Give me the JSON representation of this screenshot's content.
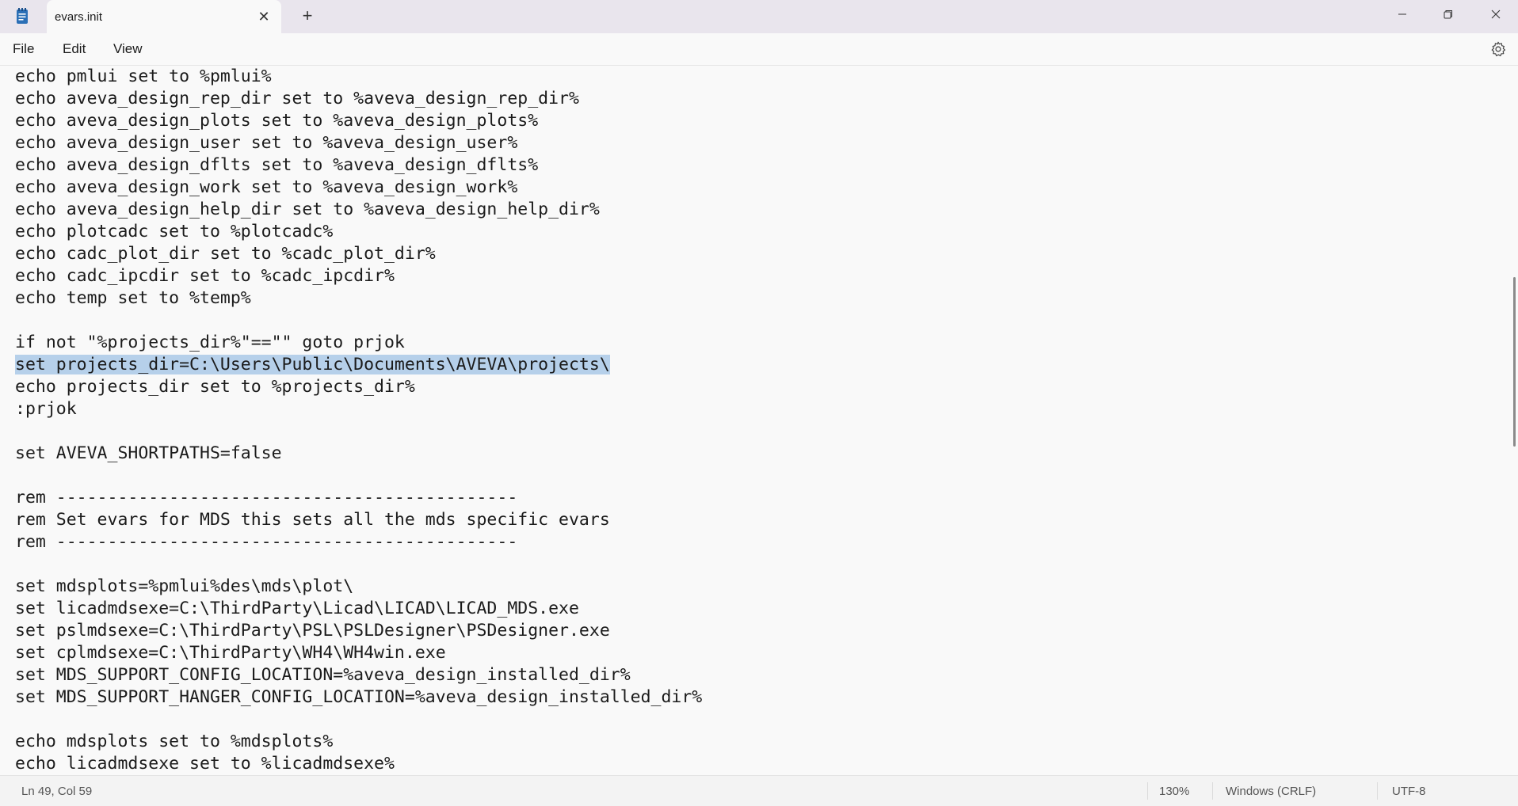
{
  "window": {
    "tab_title": "evars.init",
    "new_tab_symbol": "+",
    "close_tab_symbol": "✕"
  },
  "menu": {
    "items": [
      "File",
      "Edit",
      "View"
    ]
  },
  "editor": {
    "lines": [
      "echo pmlui set to %pmlui%",
      "echo aveva_design_rep_dir set to %aveva_design_rep_dir%",
      "echo aveva_design_plots set to %aveva_design_plots%",
      "echo aveva_design_user set to %aveva_design_user%",
      "echo aveva_design_dflts set to %aveva_design_dflts%",
      "echo aveva_design_work set to %aveva_design_work%",
      "echo aveva_design_help_dir set to %aveva_design_help_dir%",
      "echo plotcadc set to %plotcadc%",
      "echo cadc_plot_dir set to %cadc_plot_dir%",
      "echo cadc_ipcdir set to %cadc_ipcdir%",
      "echo temp set to %temp%",
      "",
      "if not \"%projects_dir%\"==\"\" goto prjok",
      "set projects_dir=C:\\Users\\Public\\Documents\\AVEVA\\projects\\",
      "echo projects_dir set to %projects_dir%",
      ":prjok",
      "",
      "set AVEVA_SHORTPATHS=false",
      "",
      "rem ---------------------------------------------",
      "rem Set evars for MDS this sets all the mds specific evars",
      "rem ---------------------------------------------",
      "",
      "set mdsplots=%pmlui%des\\mds\\plot\\",
      "set licadmdsexe=C:\\ThirdParty\\Licad\\LICAD\\LICAD_MDS.exe",
      "set pslmdsexe=C:\\ThirdParty\\PSL\\PSLDesigner\\PSDesigner.exe",
      "set cplmdsexe=C:\\ThirdParty\\WH4\\WH4win.exe",
      "set MDS_SUPPORT_CONFIG_LOCATION=%aveva_design_installed_dir%",
      "set MDS_SUPPORT_HANGER_CONFIG_LOCATION=%aveva_design_installed_dir%",
      "",
      "echo mdsplots set to %mdsplots%",
      "echo licadmdsexe set to %licadmdsexe%"
    ],
    "selected_line_index": 13
  },
  "status": {
    "cursor": "Ln 49, Col 59",
    "zoom": "130%",
    "line_ending": "Windows (CRLF)",
    "encoding": "UTF-8"
  },
  "colors": {
    "selection": "#b6d0ea",
    "titlebar": "#e9e5ed",
    "app_icon": "#2b6fb6"
  }
}
